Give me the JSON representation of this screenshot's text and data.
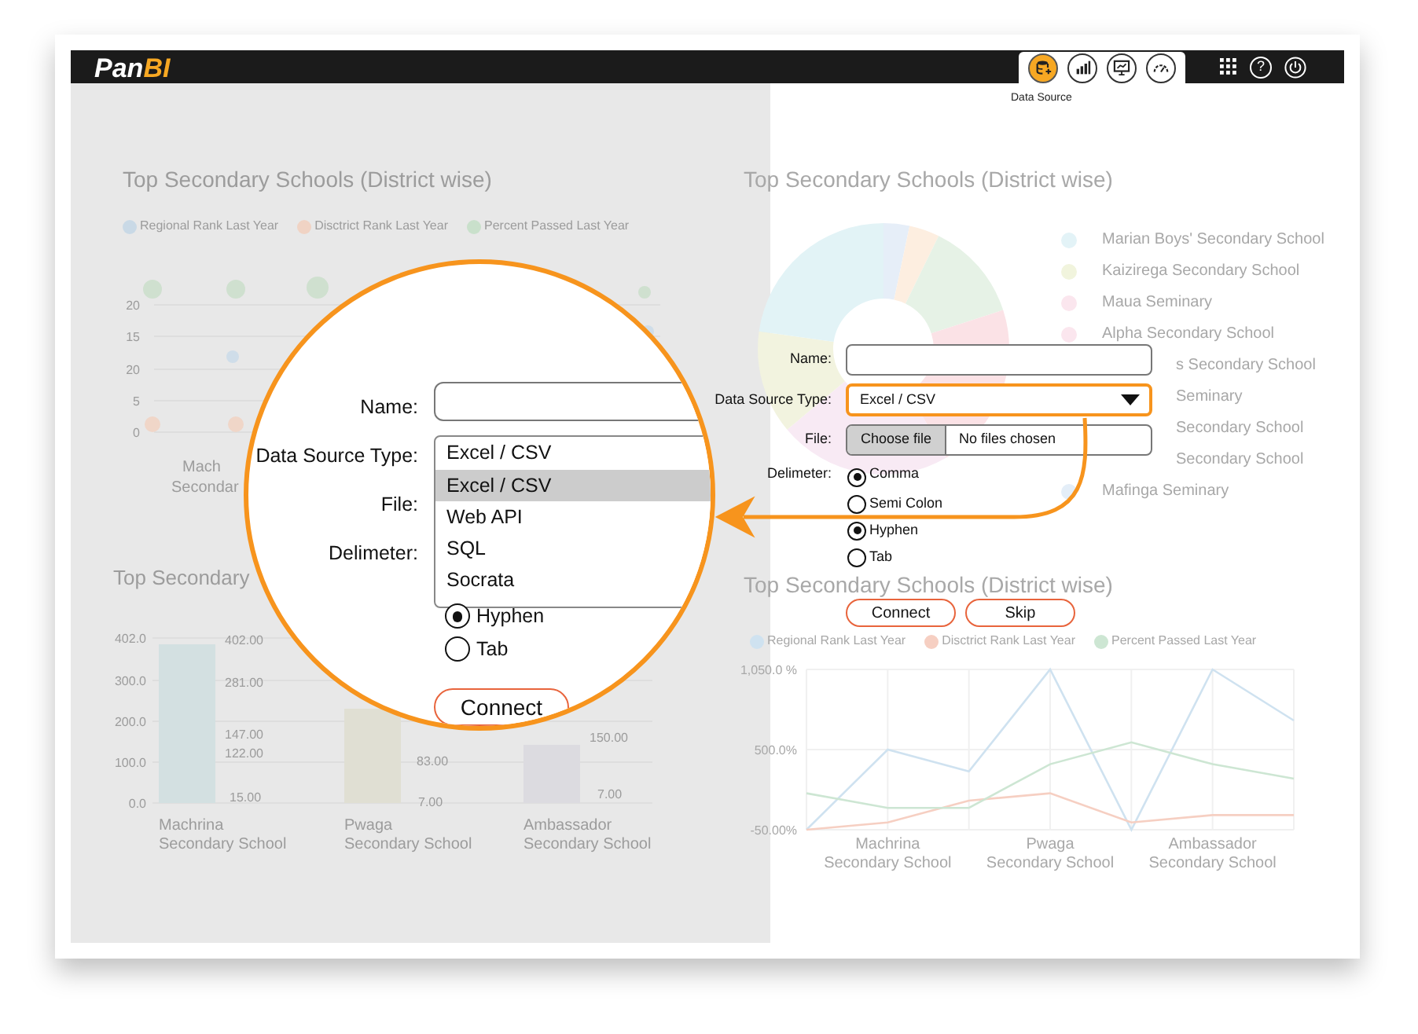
{
  "header": {
    "logo": [
      "Pan",
      "BI"
    ],
    "tabs": [
      {
        "selected": true
      },
      {
        "selected": false
      },
      {
        "selected": false
      },
      {
        "selected": false
      }
    ],
    "tab_label": "Data Source",
    "actions": [
      {
        "kind": "apps"
      },
      {
        "kind": "help",
        "glyph": "?"
      },
      {
        "kind": "power"
      }
    ]
  },
  "bubble_panel": {
    "title": "Top Secondary Schools (District wise)",
    "legend": [
      {
        "label": "Regional Rank Last Year",
        "color": "#c9d9e6"
      },
      {
        "label": "Disctrict Rank Last Year",
        "color": "#f0d3c4"
      },
      {
        "label": "Percent Passed Last Year",
        "color": "#c9e0cb"
      }
    ],
    "yticks": [
      "20",
      "15",
      "20",
      "5",
      "0"
    ],
    "category_lines": [
      "Mach",
      "Secondar"
    ]
  },
  "donut_panel": {
    "title": "Top Secondary Schools (District wise)",
    "legend": [
      {
        "label": "Marian Boys' Secondary School",
        "color": "#e3f3f7"
      },
      {
        "label": "Kaizirega Secondary School",
        "color": "#f1f4dd"
      },
      {
        "label": "Maua Seminary",
        "color": "#fbe6ee"
      },
      {
        "label": "Alpha Secondary School",
        "color": "#fbe6ee"
      },
      {
        "label": "s Secondary School",
        "covered": true
      },
      {
        "label": "Seminary",
        "covered": true
      },
      {
        "label": "Secondary School",
        "covered": true
      },
      {
        "label": "Secondary School",
        "covered": true
      },
      {
        "label": "Mafinga Seminary",
        "color": "#e4eef8"
      }
    ]
  },
  "bar_panel": {
    "title": "Top Secondary",
    "yticks": [
      "402.0",
      "300.0",
      "200.0",
      "100.0",
      "0.0"
    ],
    "value_labels": [
      "402.00",
      "281.00",
      "147.00",
      "122.00",
      "15.00",
      "83.00",
      "7.00",
      "150.00",
      "7.00"
    ],
    "categories": [
      {
        "lines": [
          "Machrina",
          "Secondary School"
        ]
      },
      {
        "lines": [
          "Pwaga",
          "Secondary School"
        ]
      },
      {
        "lines": [
          "Ambassador",
          "Secondary School"
        ]
      }
    ]
  },
  "line_panel": {
    "title": "Top Secondary Schools (District wise)",
    "chart_data": {
      "type": "line",
      "categories": [
        null,
        "Machrina Secondary School",
        null,
        "Pwaga Secondary School",
        null,
        "Ambassador Secondary School",
        null
      ],
      "series": [
        {
          "name": "Regional Rank Last Year",
          "color": "#cfe2f0",
          "values": [
            -50,
            500,
            350,
            1050,
            -50,
            1050,
            700
          ]
        },
        {
          "name": "Disctrict Rank Last Year",
          "color": "#f6cfc2",
          "values": [
            -50,
            0,
            150,
            200,
            0,
            50,
            50
          ]
        },
        {
          "name": "Percent Passed Last Year",
          "color": "#cde6d3",
          "values": [
            200,
            100,
            100,
            400,
            550,
            400,
            300
          ]
        }
      ],
      "grid": true,
      "ylim": [
        -50,
        1050
      ],
      "yticks": [
        {
          "value": 1050,
          "label": "1,050.0 %"
        },
        {
          "value": 500,
          "label": "500.0%"
        },
        {
          "value": -50,
          "label": "-50.00%"
        }
      ]
    }
  },
  "form": {
    "fields": [
      {
        "kind": "text",
        "label": "Name:"
      },
      {
        "kind": "select",
        "label": "Data Source Type:",
        "value": "Excel / CSV",
        "highlighted": true
      },
      {
        "kind": "file",
        "label": "File:",
        "button": "Choose file",
        "value": "No files chosen"
      },
      {
        "kind": "radio",
        "label": "Delimeter:",
        "options": [
          {
            "label": "Comma",
            "selected": true
          },
          {
            "label": "Semi Colon",
            "selected": false
          },
          {
            "label": "Hyphen",
            "selected": true
          },
          {
            "label": "Tab",
            "selected": false
          }
        ]
      }
    ],
    "buttons": [
      "Connect",
      "Skip"
    ]
  },
  "magnifier": {
    "labels": [
      "Name:",
      "Data Source Type:",
      "File:",
      "Delimeter:"
    ],
    "select_value": "Excel / CSV",
    "options": [
      {
        "label": "Excel / CSV",
        "selected": true
      },
      {
        "label": "Web API",
        "selected": false
      },
      {
        "label": "SQL",
        "selected": false
      },
      {
        "label": "Socrata",
        "selected": false
      }
    ],
    "radios": [
      {
        "label": "Hyphen",
        "selected": true
      },
      {
        "label": "Tab",
        "selected": false
      }
    ],
    "button": "Connect"
  }
}
